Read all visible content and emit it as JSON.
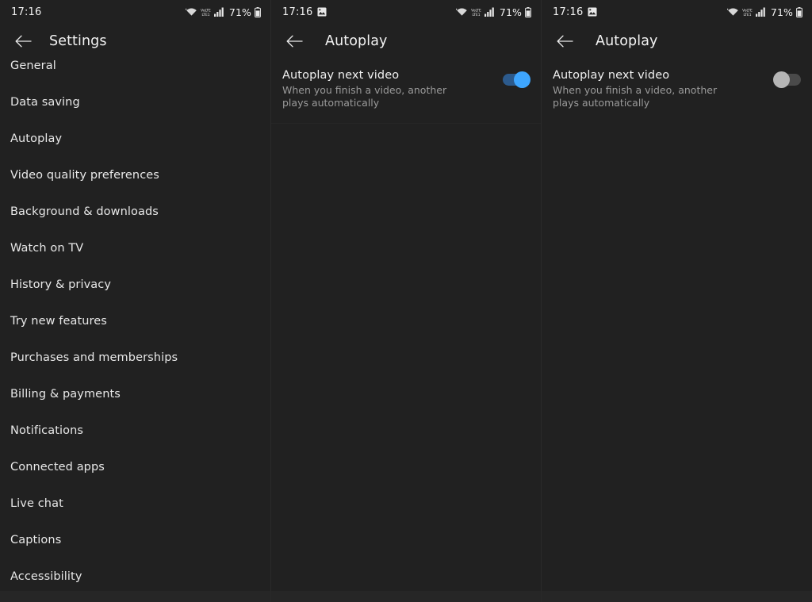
{
  "status_bar": {
    "time": "17:16",
    "battery_percent": "71%",
    "icons": [
      "screenshot-image-icon",
      "wifi-icon",
      "volte-icon",
      "signal-bars-icon",
      "battery-icon"
    ],
    "volte_label_top": "VoLTE",
    "volte_label_bottom": "LTE1"
  },
  "panels": [
    {
      "id": "settings-panel",
      "app_bar": {
        "back_icon": "back-arrow-icon",
        "title": "Settings"
      },
      "has_image_icon": false,
      "list": [
        {
          "label": "General"
        },
        {
          "label": "Data saving"
        },
        {
          "label": "Autoplay"
        },
        {
          "label": "Video quality preferences"
        },
        {
          "label": "Background & downloads"
        },
        {
          "label": "Watch on TV"
        },
        {
          "label": "History & privacy"
        },
        {
          "label": "Try new features"
        },
        {
          "label": "Purchases and memberships"
        },
        {
          "label": "Billing & payments"
        },
        {
          "label": "Notifications"
        },
        {
          "label": "Connected apps"
        },
        {
          "label": "Live chat"
        },
        {
          "label": "Captions"
        },
        {
          "label": "Accessibility"
        }
      ]
    },
    {
      "id": "autoplay-panel-on",
      "app_bar": {
        "back_icon": "back-arrow-icon",
        "title": "Autoplay"
      },
      "has_image_icon": true,
      "preference": {
        "title": "Autoplay next video",
        "subtitle": "When you finish a video, another plays automatically",
        "toggle_state": "on",
        "toggle_on_color": "#3ea6ff",
        "toggle_track_color": "#2c5a8c"
      }
    },
    {
      "id": "autoplay-panel-off",
      "app_bar": {
        "back_icon": "back-arrow-icon",
        "title": "Autoplay"
      },
      "has_image_icon": true,
      "preference": {
        "title": "Autoplay next video",
        "subtitle": "When you finish a video, another plays automatically",
        "toggle_state": "off",
        "toggle_off_color": "#b6b6b6",
        "toggle_track_color": "#4a4a4a"
      }
    }
  ],
  "theme": {
    "background": "#212121",
    "text_primary": "#f0f0f0",
    "text_secondary": "#9a9a9a",
    "accent": "#3ea6ff"
  }
}
